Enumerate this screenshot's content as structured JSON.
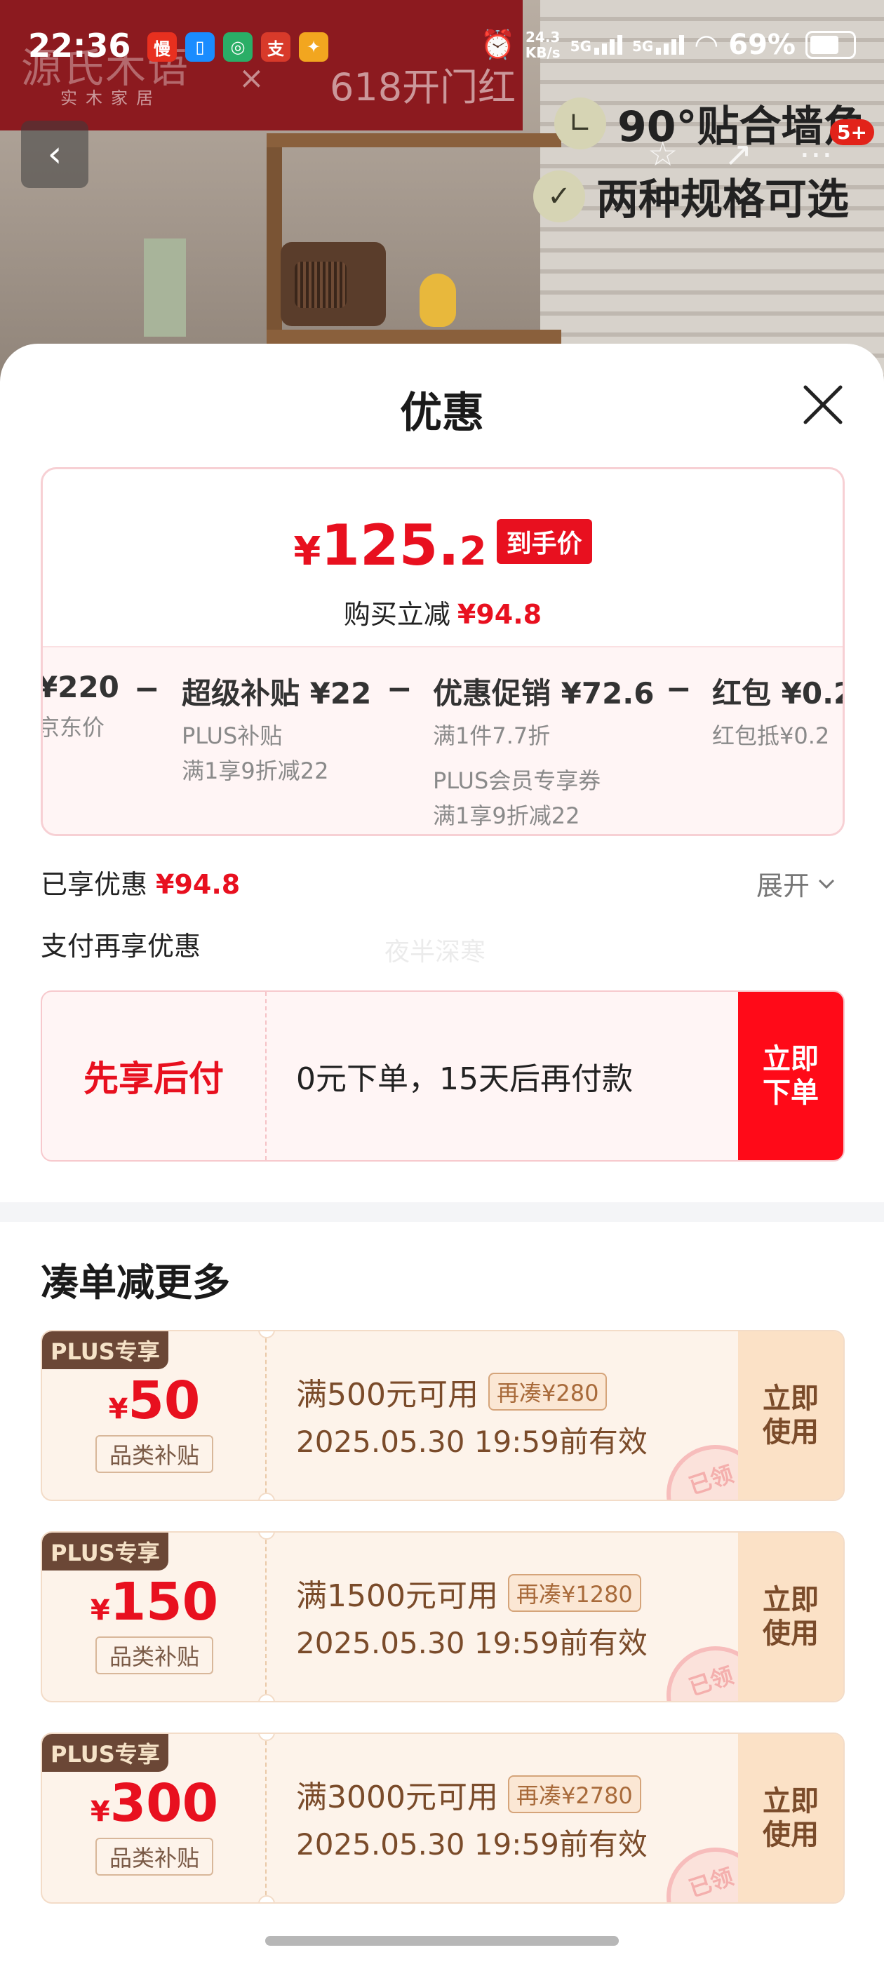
{
  "status_bar": {
    "time": "22:36",
    "network_speed_value": "24.3",
    "network_speed_unit": "KB/s",
    "signal_1": "5G",
    "signal_2": "5G",
    "battery": "69%",
    "icons": [
      "alarm-icon",
      "wifi-icon",
      "battery-icon"
    ]
  },
  "hero": {
    "brand_name": "源氏木语",
    "brand_sub": "实木家居",
    "brand_x": "×",
    "campaign": "618开门红",
    "feature_1": "90°贴合墙角",
    "feature_2": "两种规格可选",
    "notification_badge": "5+"
  },
  "sheet": {
    "title": "优惠",
    "final_price": {
      "currency": "¥",
      "integer": "125.",
      "decimal": "2",
      "tag": "到手价"
    },
    "instant_discount_label": "购买立减",
    "instant_discount_value": "¥94.8",
    "breakdown": [
      {
        "head": "¥220",
        "sub": "京东价"
      },
      {
        "head": "超级补贴 ¥22",
        "sub": "PLUS补贴",
        "sub2": "满1享9折减22"
      },
      {
        "head": "优惠促销 ¥72.6",
        "sub": "满1件7.7折",
        "sub2": "PLUS会员专享券",
        "sub3": "满1享9折减22"
      },
      {
        "head": "红包 ¥0.2",
        "sub": "红包抵¥0.2"
      }
    ],
    "minus_sign": "−",
    "enjoyed_label": "已享优惠",
    "enjoyed_value": "¥94.8",
    "expand_label": "展开",
    "pay_more_label": "支付再享优惠",
    "watermark": "夜半深寒",
    "bnpl": {
      "title": "先享后付",
      "desc": "0元下单，15天后再付款",
      "button": "立即下单"
    },
    "section_title": "凑单减更多",
    "coupons": [
      {
        "tag": "PLUS专享",
        "currency": "¥",
        "amount": "50",
        "label": "品类补贴",
        "condition": "满500元可用",
        "add_more": "再凑¥280",
        "validity": "2025.05.30 19:59前有效",
        "button": "立即使用",
        "stamp": "已领"
      },
      {
        "tag": "PLUS专享",
        "currency": "¥",
        "amount": "150",
        "label": "品类补贴",
        "condition": "满1500元可用",
        "add_more": "再凑¥1280",
        "validity": "2025.05.30 19:59前有效",
        "button": "立即使用",
        "stamp": "已领"
      },
      {
        "tag": "PLUS专享",
        "currency": "¥",
        "amount": "300",
        "label": "品类补贴",
        "condition": "满3000元可用",
        "add_more": "再凑¥2780",
        "validity": "2025.05.30 19:59前有效",
        "button": "立即使用",
        "stamp": "已领"
      }
    ]
  },
  "colors": {
    "accent_red": "#e8101f",
    "coupon_brown": "#7a4b2a",
    "coupon_bg": "#fdf3ea"
  }
}
